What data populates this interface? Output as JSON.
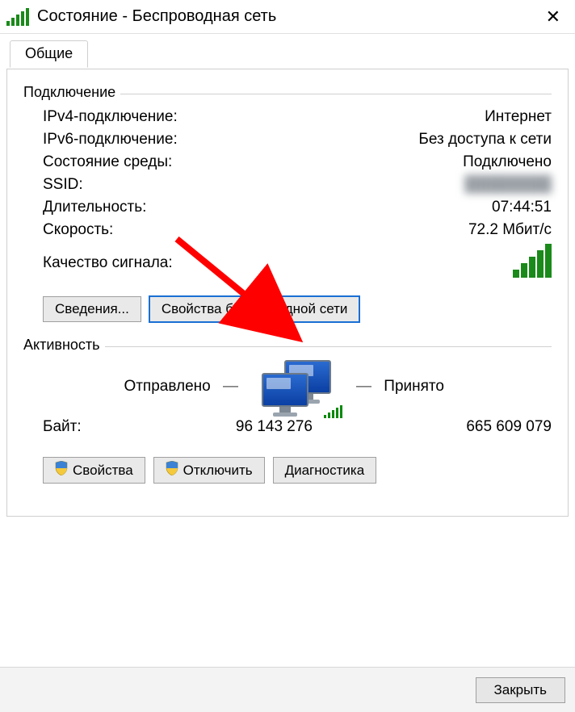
{
  "window": {
    "title": "Состояние - Беспроводная сеть",
    "close_glyph": "✕"
  },
  "tab": {
    "general": "Общие"
  },
  "connection": {
    "group_label": "Подключение",
    "rows": {
      "ipv4_label": "IPv4-подключение:",
      "ipv4_value": "Интернет",
      "ipv6_label": "IPv6-подключение:",
      "ipv6_value": "Без доступа к сети",
      "media_label": "Состояние среды:",
      "media_value": "Подключено",
      "ssid_label": "SSID:",
      "ssid_value": "████████",
      "duration_label": "Длительность:",
      "duration_value": "07:44:51",
      "speed_label": "Скорость:",
      "speed_value": "72.2 Мбит/с",
      "signal_label": "Качество сигнала:"
    },
    "buttons": {
      "details": "Сведения...",
      "wireless_props": "Свойства беспроводной сети"
    }
  },
  "activity": {
    "group_label": "Активность",
    "sent_label": "Отправлено",
    "recv_label": "Принято",
    "dashes": "— —",
    "bytes_label": "Байт:",
    "sent_value": "96 143 276",
    "recv_value": "665 609 079",
    "buttons": {
      "properties": "Свойства",
      "disable": "Отключить",
      "diagnose": "Диагностика"
    }
  },
  "footer": {
    "close": "Закрыть"
  },
  "icons": {
    "signal": "signal-bars-icon",
    "shield": "shield-icon",
    "computers": "network-computers-icon",
    "close": "close-icon"
  }
}
